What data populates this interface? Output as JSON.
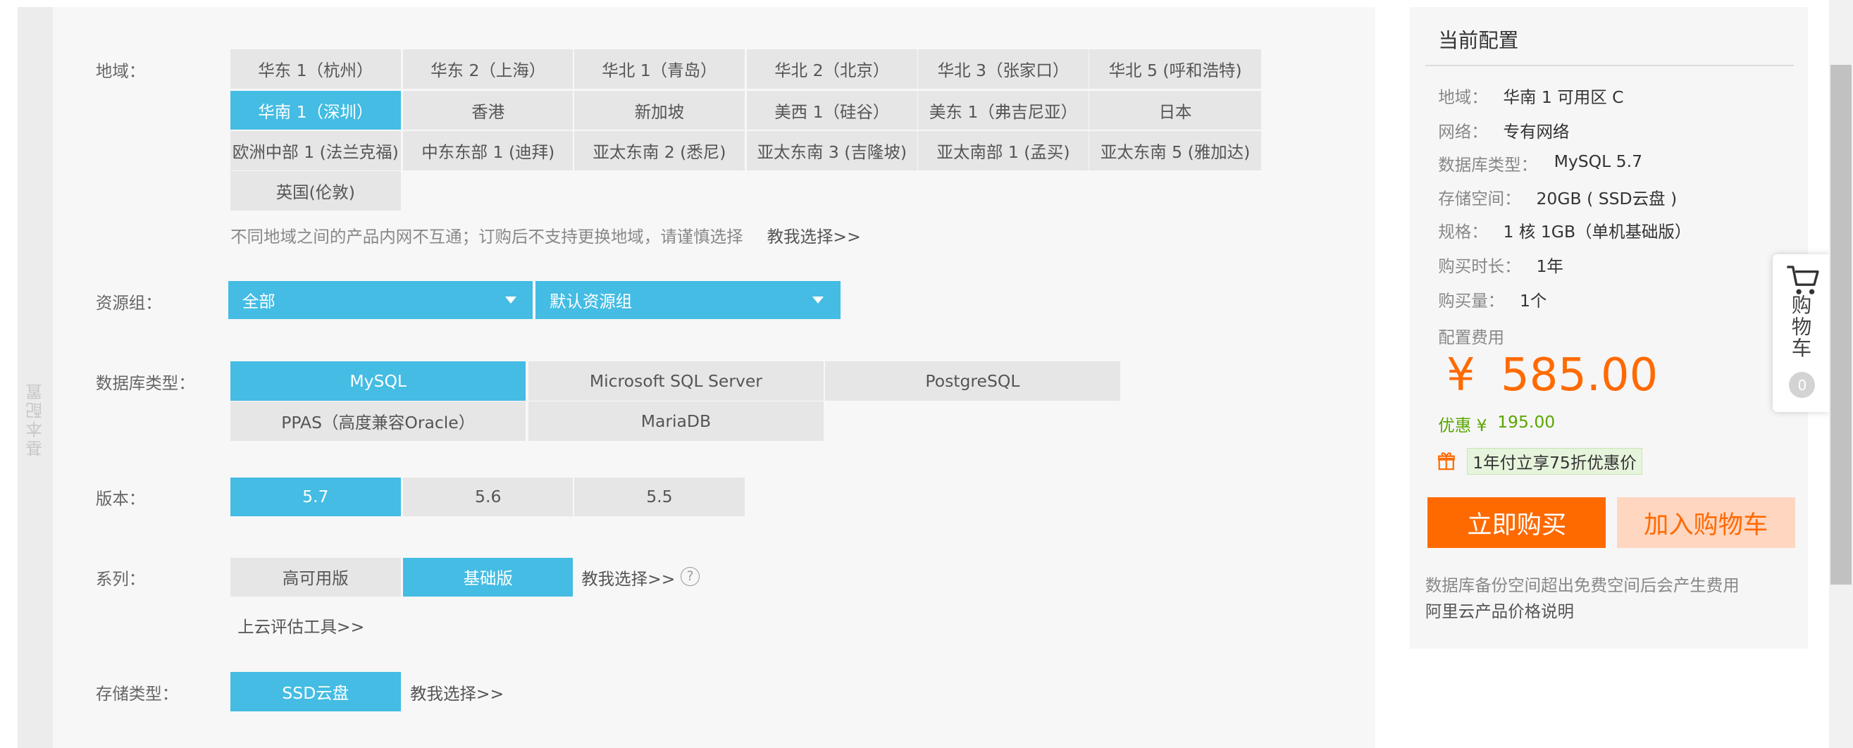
{
  "section_label": "基本配置",
  "region": {
    "label": "地域：",
    "options": [
      "华东 1（杭州）",
      "华东 2（上海）",
      "华北 1（青岛）",
      "华北 2（北京）",
      "华北 3（张家口）",
      "华北 5 (呼和浩特)",
      "华南 1（深圳）",
      "香港",
      "新加坡",
      "美西 1（硅谷）",
      "美东 1（弗吉尼亚）",
      "日本",
      "欧洲中部 1 (法兰克福)",
      "中东东部 1 (迪拜)",
      "亚太东南 2 (悉尼)",
      "亚太东南 3 (吉隆坡)",
      "亚太南部 1 (孟买)",
      "亚太东南 5 (雅加达)",
      "英国(伦敦)"
    ],
    "selected": "华南 1（深圳）",
    "note": "不同地域之间的产品内网不互通；订购后不支持更换地域，请谨慎选择",
    "help_link": "教我选择>>"
  },
  "resource_group": {
    "label": "资源组：",
    "select1": "全部",
    "select2": "默认资源组"
  },
  "db_type": {
    "label": "数据库类型：",
    "options": [
      "MySQL",
      "Microsoft SQL Server",
      "PostgreSQL",
      "PPAS（高度兼容Oracle）",
      "MariaDB"
    ],
    "selected": "MySQL"
  },
  "version": {
    "label": "版本：",
    "options": [
      "5.7",
      "5.6",
      "5.5"
    ],
    "selected": "5.7"
  },
  "series": {
    "label": "系列：",
    "options": [
      "高可用版",
      "基础版"
    ],
    "selected": "基础版",
    "help_link": "教我选择>>",
    "help_icon": "?",
    "eval_link": "上云评估工具>>"
  },
  "storage": {
    "label": "存储类型：",
    "options": [
      "SSD云盘"
    ],
    "selected": "SSD云盘",
    "help_link": "教我选择>>"
  },
  "summary": {
    "title": "当前配置",
    "rows": [
      {
        "key": "地域：",
        "value": "华南 1 可用区 C"
      },
      {
        "key": "网络：",
        "value": "专有网络"
      },
      {
        "key": "数据库类型：",
        "value": "MySQL 5.7"
      },
      {
        "key": "存储空间：",
        "value": "20GB ( SSD云盘 )"
      },
      {
        "key": "规格：",
        "value": "1 核 1GB（单机基础版）"
      },
      {
        "key": "购买时长：",
        "value": "1年"
      },
      {
        "key": "购买量：",
        "value": "1个"
      }
    ],
    "fee_label": "配置费用",
    "currency": "¥",
    "price": "585.00",
    "discount_label": "优惠 ¥",
    "discount_value": "195.00",
    "promo": "1年付立享75折优惠价",
    "buy_now": "立即购买",
    "add_cart": "加入购物车",
    "backup_note": "数据库备份空间超出免费空间后会产生费用",
    "pricing_link": "阿里云产品价格说明"
  },
  "cart": {
    "label_chars": [
      "购",
      "物",
      "车"
    ],
    "count": "0"
  },
  "colors": {
    "selected": "#44bce3",
    "unselected": "#e6e6e6",
    "accent_orange": "#ff6a00",
    "discount_green": "#5aa700"
  }
}
